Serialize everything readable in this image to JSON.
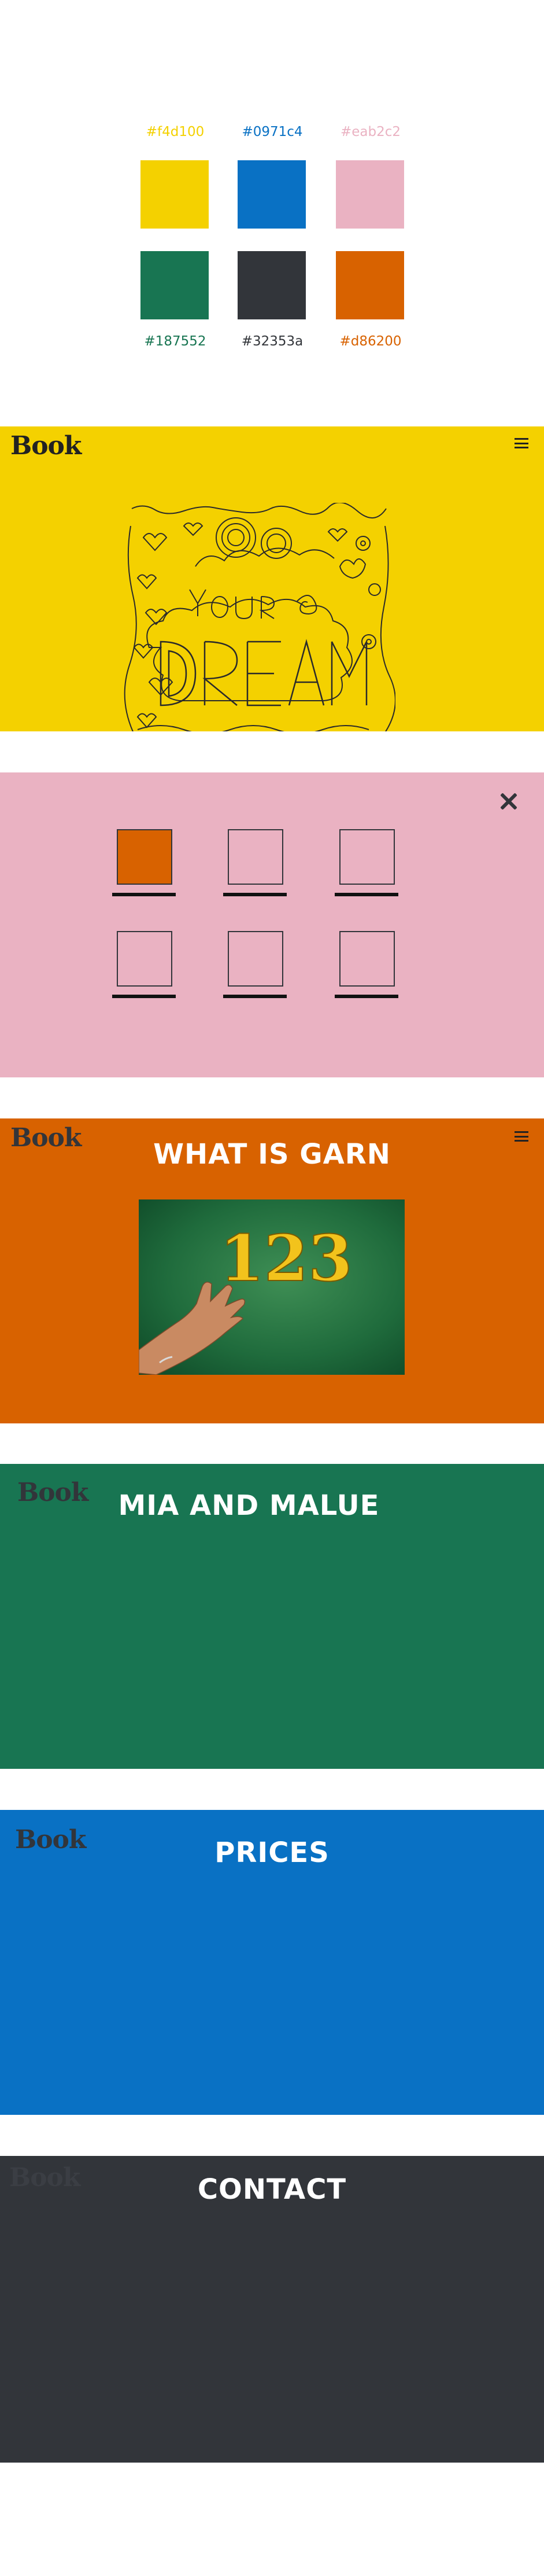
{
  "palette": {
    "swatches": [
      {
        "hex": "#f4d100",
        "label": "#f4d100"
      },
      {
        "hex": "#0971c4",
        "label": "#0971c4"
      },
      {
        "hex": "#eab2c2",
        "label": "#eab2c2"
      },
      {
        "hex": "#187552",
        "label": "#187552"
      },
      {
        "hex": "#32353a",
        "label": "#32353a"
      },
      {
        "hex": "#d86200",
        "label": "#d86200"
      }
    ]
  },
  "brand": {
    "logo": "Book"
  },
  "hero": {
    "background": "#f4d100",
    "menu_icon": "hamburger-icon",
    "art": "hand-drawn your dream doodle"
  },
  "menu_overlay": {
    "background": "#eab2c2",
    "close_icon": "close-icon",
    "items_checked": [
      true,
      false,
      false,
      false,
      false,
      false
    ]
  },
  "what_is_garn": {
    "background": "#d86200",
    "title": "WHAT IS GARN",
    "image_text": "123",
    "menu_icon": "hamburger-icon"
  },
  "mia_and_malue": {
    "background": "#187552",
    "title": "MIA AND MALUE"
  },
  "prices": {
    "background": "#0971c4",
    "title": "PRICES"
  },
  "contact": {
    "background": "#32353a",
    "title": "CONTACT"
  }
}
